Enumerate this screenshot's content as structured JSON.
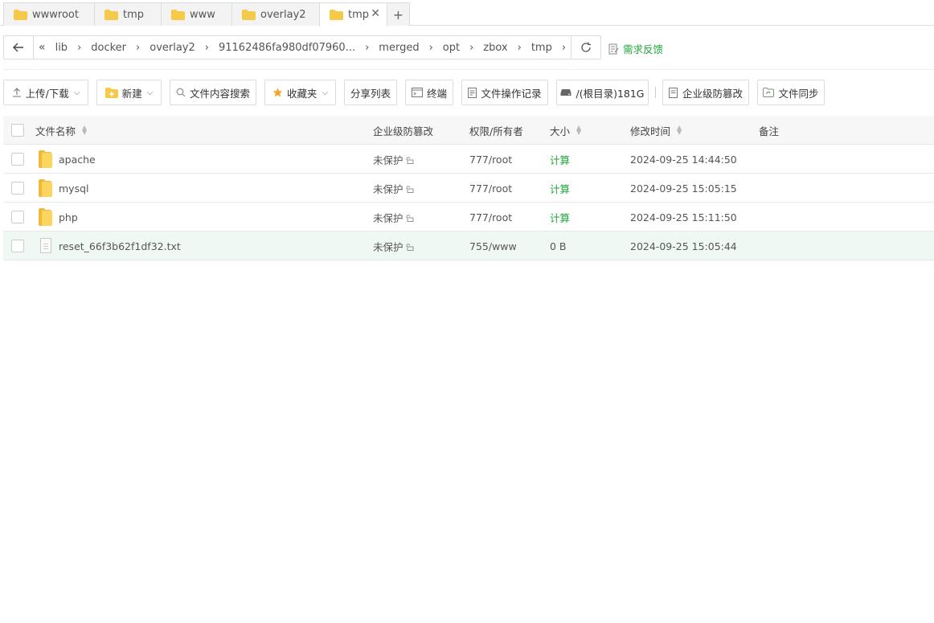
{
  "tabs": [
    {
      "label": "wwwroot"
    },
    {
      "label": "tmp"
    },
    {
      "label": "www"
    },
    {
      "label": "overlay2"
    },
    {
      "label": "tmp",
      "active": true
    }
  ],
  "tab_add_label": "+",
  "path": {
    "crumbs": [
      "lib",
      "docker",
      "overlay2",
      "91162486fa980df07960...",
      "merged",
      "opt",
      "zbox",
      "tmp"
    ]
  },
  "feedback_label": "需求反馈",
  "toolbar": {
    "upload_label": "上传/下载",
    "new_label": "新建",
    "search_label": "文件内容搜索",
    "favorites_label": "收藏夹",
    "share_label": "分享列表",
    "terminal_label": "终端",
    "oplog_label": "文件操作记录",
    "disk_label": "/(根目录)181G",
    "tamper_label": "企业级防篡改",
    "sync_label": "文件同步"
  },
  "table": {
    "headers": {
      "name": "文件名称",
      "tamper": "企业级防篡改",
      "perm": "权限/所有者",
      "size": "大小",
      "mtime": "修改时间",
      "note": "备注"
    },
    "rows": [
      {
        "type": "folder",
        "name": "apache",
        "tamper": "未保护",
        "perm": "777/root",
        "size": "计算",
        "mtime": "2024-09-25 14:44:50"
      },
      {
        "type": "folder",
        "name": "mysql",
        "tamper": "未保护",
        "perm": "777/root",
        "size": "计算",
        "mtime": "2024-09-25 15:05:15"
      },
      {
        "type": "folder",
        "name": "php",
        "tamper": "未保护",
        "perm": "777/root",
        "size": "计算",
        "mtime": "2024-09-25 15:11:50"
      },
      {
        "type": "file",
        "name": "reset_66f3b62f1df32.txt",
        "tamper": "未保护",
        "perm": "755/www",
        "size": "0 B",
        "mtime": "2024-09-25 15:05:44"
      }
    ]
  },
  "colors": {
    "accent": "#20a53a",
    "folder": "#f7c948",
    "border": "#dcdcdc"
  }
}
